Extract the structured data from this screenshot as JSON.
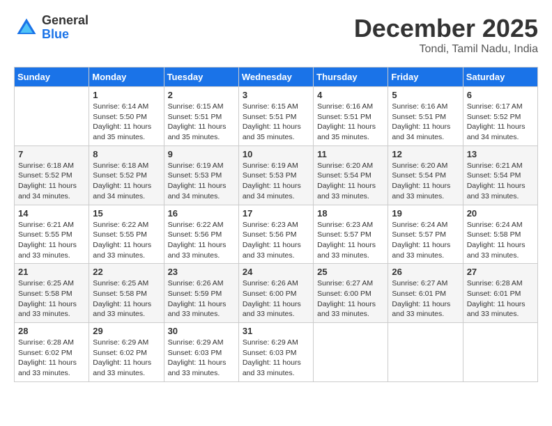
{
  "header": {
    "logo_general": "General",
    "logo_blue": "Blue",
    "month_title": "December 2025",
    "location": "Tondi, Tamil Nadu, India"
  },
  "calendar": {
    "days_of_week": [
      "Sunday",
      "Monday",
      "Tuesday",
      "Wednesday",
      "Thursday",
      "Friday",
      "Saturday"
    ],
    "weeks": [
      [
        {
          "day": "",
          "info": ""
        },
        {
          "day": "1",
          "info": "Sunrise: 6:14 AM\nSunset: 5:50 PM\nDaylight: 11 hours\nand 35 minutes."
        },
        {
          "day": "2",
          "info": "Sunrise: 6:15 AM\nSunset: 5:51 PM\nDaylight: 11 hours\nand 35 minutes."
        },
        {
          "day": "3",
          "info": "Sunrise: 6:15 AM\nSunset: 5:51 PM\nDaylight: 11 hours\nand 35 minutes."
        },
        {
          "day": "4",
          "info": "Sunrise: 6:16 AM\nSunset: 5:51 PM\nDaylight: 11 hours\nand 35 minutes."
        },
        {
          "day": "5",
          "info": "Sunrise: 6:16 AM\nSunset: 5:51 PM\nDaylight: 11 hours\nand 34 minutes."
        },
        {
          "day": "6",
          "info": "Sunrise: 6:17 AM\nSunset: 5:52 PM\nDaylight: 11 hours\nand 34 minutes."
        }
      ],
      [
        {
          "day": "7",
          "info": "Sunrise: 6:18 AM\nSunset: 5:52 PM\nDaylight: 11 hours\nand 34 minutes."
        },
        {
          "day": "8",
          "info": "Sunrise: 6:18 AM\nSunset: 5:52 PM\nDaylight: 11 hours\nand 34 minutes."
        },
        {
          "day": "9",
          "info": "Sunrise: 6:19 AM\nSunset: 5:53 PM\nDaylight: 11 hours\nand 34 minutes."
        },
        {
          "day": "10",
          "info": "Sunrise: 6:19 AM\nSunset: 5:53 PM\nDaylight: 11 hours\nand 34 minutes."
        },
        {
          "day": "11",
          "info": "Sunrise: 6:20 AM\nSunset: 5:54 PM\nDaylight: 11 hours\nand 33 minutes."
        },
        {
          "day": "12",
          "info": "Sunrise: 6:20 AM\nSunset: 5:54 PM\nDaylight: 11 hours\nand 33 minutes."
        },
        {
          "day": "13",
          "info": "Sunrise: 6:21 AM\nSunset: 5:54 PM\nDaylight: 11 hours\nand 33 minutes."
        }
      ],
      [
        {
          "day": "14",
          "info": "Sunrise: 6:21 AM\nSunset: 5:55 PM\nDaylight: 11 hours\nand 33 minutes."
        },
        {
          "day": "15",
          "info": "Sunrise: 6:22 AM\nSunset: 5:55 PM\nDaylight: 11 hours\nand 33 minutes."
        },
        {
          "day": "16",
          "info": "Sunrise: 6:22 AM\nSunset: 5:56 PM\nDaylight: 11 hours\nand 33 minutes."
        },
        {
          "day": "17",
          "info": "Sunrise: 6:23 AM\nSunset: 5:56 PM\nDaylight: 11 hours\nand 33 minutes."
        },
        {
          "day": "18",
          "info": "Sunrise: 6:23 AM\nSunset: 5:57 PM\nDaylight: 11 hours\nand 33 minutes."
        },
        {
          "day": "19",
          "info": "Sunrise: 6:24 AM\nSunset: 5:57 PM\nDaylight: 11 hours\nand 33 minutes."
        },
        {
          "day": "20",
          "info": "Sunrise: 6:24 AM\nSunset: 5:58 PM\nDaylight: 11 hours\nand 33 minutes."
        }
      ],
      [
        {
          "day": "21",
          "info": "Sunrise: 6:25 AM\nSunset: 5:58 PM\nDaylight: 11 hours\nand 33 minutes."
        },
        {
          "day": "22",
          "info": "Sunrise: 6:25 AM\nSunset: 5:58 PM\nDaylight: 11 hours\nand 33 minutes."
        },
        {
          "day": "23",
          "info": "Sunrise: 6:26 AM\nSunset: 5:59 PM\nDaylight: 11 hours\nand 33 minutes."
        },
        {
          "day": "24",
          "info": "Sunrise: 6:26 AM\nSunset: 6:00 PM\nDaylight: 11 hours\nand 33 minutes."
        },
        {
          "day": "25",
          "info": "Sunrise: 6:27 AM\nSunset: 6:00 PM\nDaylight: 11 hours\nand 33 minutes."
        },
        {
          "day": "26",
          "info": "Sunrise: 6:27 AM\nSunset: 6:01 PM\nDaylight: 11 hours\nand 33 minutes."
        },
        {
          "day": "27",
          "info": "Sunrise: 6:28 AM\nSunset: 6:01 PM\nDaylight: 11 hours\nand 33 minutes."
        }
      ],
      [
        {
          "day": "28",
          "info": "Sunrise: 6:28 AM\nSunset: 6:02 PM\nDaylight: 11 hours\nand 33 minutes."
        },
        {
          "day": "29",
          "info": "Sunrise: 6:29 AM\nSunset: 6:02 PM\nDaylight: 11 hours\nand 33 minutes."
        },
        {
          "day": "30",
          "info": "Sunrise: 6:29 AM\nSunset: 6:03 PM\nDaylight: 11 hours\nand 33 minutes."
        },
        {
          "day": "31",
          "info": "Sunrise: 6:29 AM\nSunset: 6:03 PM\nDaylight: 11 hours\nand 33 minutes."
        },
        {
          "day": "",
          "info": ""
        },
        {
          "day": "",
          "info": ""
        },
        {
          "day": "",
          "info": ""
        }
      ]
    ]
  }
}
